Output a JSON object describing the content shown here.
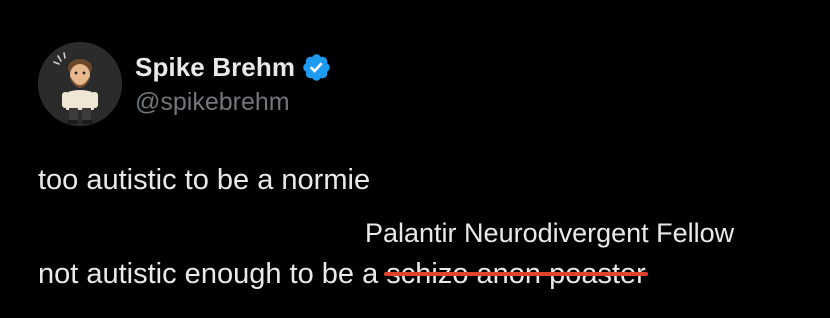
{
  "author": {
    "name": "Spike Brehm",
    "handle": "@spikebrehm",
    "verified": true,
    "verified_color": "#1d9bf0",
    "avatar_icon": "cartoon-avatar-icon"
  },
  "tweet": {
    "line1": "too autistic to be a normie",
    "line2_prefix": "not autistic enough to be a ",
    "line2_struck": "schizo anon poaster",
    "replacement": "Palantir Neurodivergent Fellow",
    "strike_color": "#e0442c"
  },
  "theme": {
    "background": "#000000",
    "text": "#e7e9ea",
    "secondary_text": "#71767b"
  }
}
